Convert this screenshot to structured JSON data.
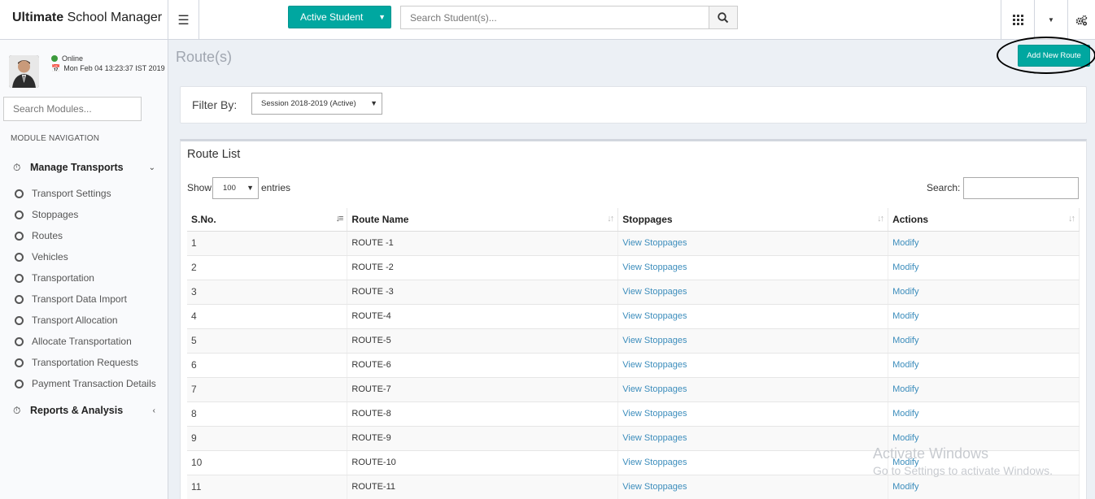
{
  "header": {
    "logo_bold": "Ultimate",
    "logo_rest": " School Manager",
    "active_student_label": "Active Student",
    "search_placeholder": "Search Student(s)..."
  },
  "sidebar": {
    "status": "Online",
    "datetime": "Mon Feb 04 13:23:37 IST 2019",
    "search_placeholder": "Search Modules...",
    "nav_heading": "MODULE NAVIGATION",
    "group_transports": "Manage Transports",
    "items": [
      "Transport Settings",
      "Stoppages",
      "Routes",
      "Vehicles",
      "Transportation",
      "Transport Data Import",
      "Transport Allocation",
      "Allocate Transportation",
      "Transportation Requests",
      "Payment Transaction Details"
    ],
    "group_reports": "Reports & Analysis"
  },
  "page": {
    "title": "Route(s)",
    "add_button": "Add New Route"
  },
  "filter": {
    "label": "Filter By:",
    "session": "Session 2018-2019 (Active)"
  },
  "list": {
    "title": "Route List",
    "show_label": "Show",
    "entries_value": "100",
    "entries_label": "entries",
    "search_label": "Search:",
    "columns": [
      "S.No.",
      "Route Name",
      "Stoppages",
      "Actions"
    ],
    "rows": [
      {
        "sno": "1",
        "name": "ROUTE -1",
        "stoppages": "View Stoppages",
        "action": "Modify"
      },
      {
        "sno": "2",
        "name": "ROUTE -2",
        "stoppages": "View Stoppages",
        "action": "Modify"
      },
      {
        "sno": "3",
        "name": "ROUTE -3",
        "stoppages": "View Stoppages",
        "action": "Modify"
      },
      {
        "sno": "4",
        "name": "ROUTE-4",
        "stoppages": "View Stoppages",
        "action": "Modify"
      },
      {
        "sno": "5",
        "name": "ROUTE-5",
        "stoppages": "View Stoppages",
        "action": "Modify"
      },
      {
        "sno": "6",
        "name": "ROUTE-6",
        "stoppages": "View Stoppages",
        "action": "Modify"
      },
      {
        "sno": "7",
        "name": "ROUTE-7",
        "stoppages": "View Stoppages",
        "action": "Modify"
      },
      {
        "sno": "8",
        "name": "ROUTE-8",
        "stoppages": "View Stoppages",
        "action": "Modify"
      },
      {
        "sno": "9",
        "name": "ROUTE-9",
        "stoppages": "View Stoppages",
        "action": "Modify"
      },
      {
        "sno": "10",
        "name": "ROUTE-10",
        "stoppages": "View Stoppages",
        "action": "Modify"
      },
      {
        "sno": "11",
        "name": "ROUTE-11",
        "stoppages": "View Stoppages",
        "action": "Modify"
      }
    ]
  },
  "watermark": {
    "line1": "Activate Windows",
    "line2": "Go to Settings to activate Windows."
  },
  "colors": {
    "accent": "#00a7a0",
    "link": "#3c8dbc",
    "online": "#3c9a3c"
  }
}
